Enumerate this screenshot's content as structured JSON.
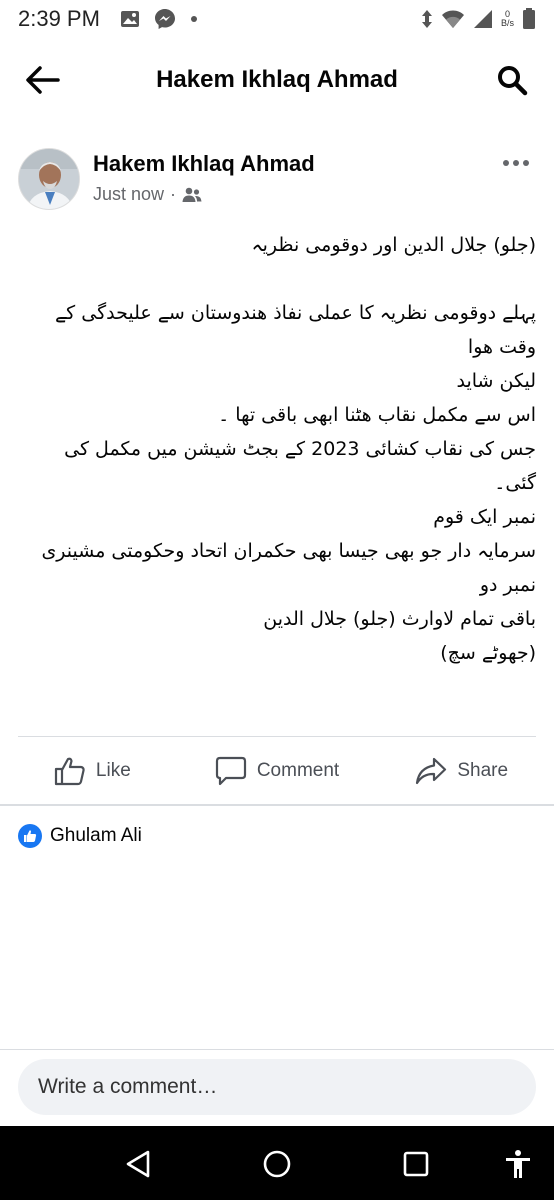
{
  "status_bar": {
    "time": "2:39 PM",
    "speed_value": "0",
    "speed_unit": "B/s",
    "icons": [
      "gallery-icon",
      "messenger-icon",
      "dot-icon",
      "data-arrows-icon",
      "wifi-icon",
      "signal-icon",
      "battery-icon"
    ]
  },
  "app_bar": {
    "title": "Hakem Ikhlaq Ahmad",
    "back_icon": "back-arrow-icon",
    "search_icon": "search-icon"
  },
  "post": {
    "author": "Hakem Ikhlaq Ahmad",
    "timestamp": "Just now",
    "separator": "·",
    "privacy_icon": "friends-icon",
    "more_icon": "more-icon",
    "lines": [
      "(جلو) جلال الدین اور دوقومی نظریہ",
      "",
      "پہلے دوقومی نظریہ کا عملی نفاذ ھندوستان سے علیحدگی کے وقت ھوا",
      "لیکن شاید",
      "اس سے مکمل نقاب ھٹنا ابھی باقی تھا ۔",
      "جس کی نقاب کشائی 2023 کے بجٹ شیشن میں مکمل کی گئی۔",
      "نمبر ایک قوم",
      "سرمایہ دار جو بھی جیسا بھی حکمران اتحاد وحکومتی مشینری",
      "نمبر دو",
      "باقی تمام لاوارث (جلو) جلال الدین",
      "(جھوٹے سچ)"
    ]
  },
  "actions": {
    "like": "Like",
    "comment": "Comment",
    "share": "Share"
  },
  "reactions": {
    "name": "Ghulam Ali"
  },
  "comment_box": {
    "placeholder": "Write a comment…"
  },
  "colors": {
    "brand_blue": "#1877f2",
    "secondary_text": "#65676b",
    "divider": "#dadde1",
    "input_bg": "#f0f2f5"
  }
}
